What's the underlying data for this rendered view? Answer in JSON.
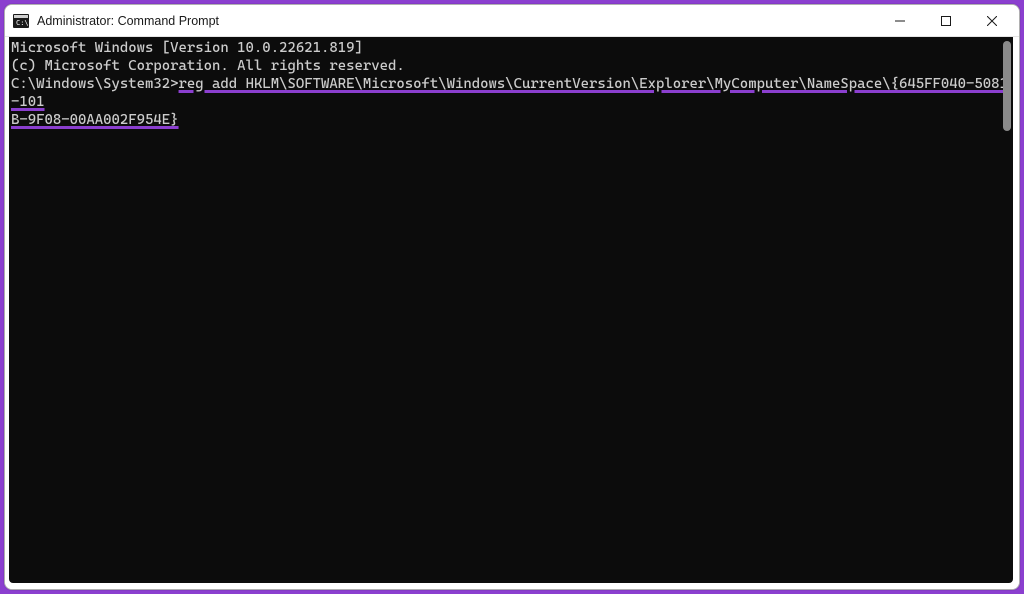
{
  "window": {
    "title": "Administrator: Command Prompt"
  },
  "terminal": {
    "line1": "Microsoft Windows [Version 10.0.22621.819]",
    "line2": "(c) Microsoft Corporation. All rights reserved.",
    "blank": "",
    "prompt": "C:\\Windows\\System32>",
    "command_part1": "reg add HKLM\\SOFTWARE\\Microsoft\\Windows\\CurrentVersion\\Explorer\\MyComputer\\NameSpace\\{645FF040-5081-101",
    "command_part2": "B-9F08-00AA002F954E}"
  }
}
